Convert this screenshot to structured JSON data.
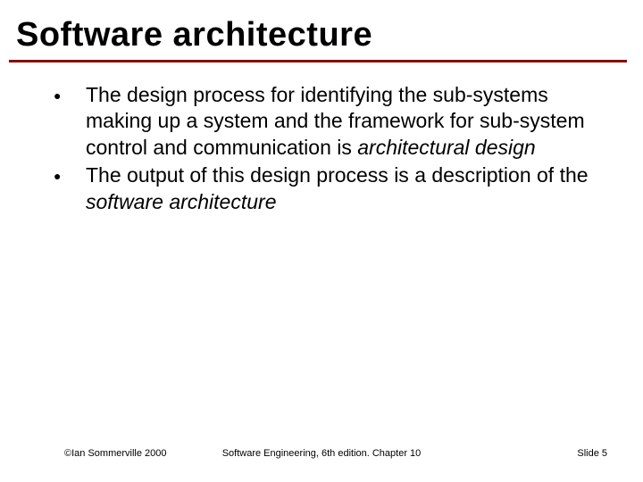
{
  "title": "Software architecture",
  "bullets": [
    {
      "pre": "The design process for identifying the sub-systems making up a system and the framework for sub-system control and communication is ",
      "ital": "architectural design",
      "post": ""
    },
    {
      "pre": "The output of this design process is a description of the ",
      "ital": "software architecture",
      "post": ""
    }
  ],
  "footer": {
    "left": "©Ian Sommerville 2000",
    "mid": "Software Engineering, 6th edition. Chapter 10",
    "right": "Slide 5"
  }
}
